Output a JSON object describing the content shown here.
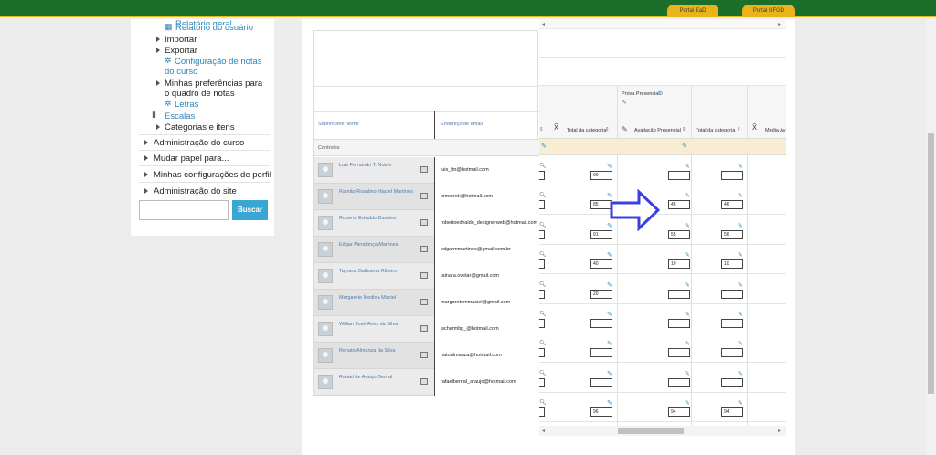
{
  "header": {
    "portal_ead": "Portal EaD",
    "portal_ufgd": "Portal UFGD"
  },
  "sidebar": {
    "partial_top": "Relatório geral",
    "relatorio_usuario": "Relatório do usuário",
    "importar": "Importar",
    "exportar": "Exportar",
    "config_notas": "Configuração de notas do curso",
    "preferencias": "Minhas preferências para o quadro de notas",
    "letras": "Letras",
    "escalas": "Escalas",
    "categorias": "Categorias e itens",
    "admin_curso": "Administração do curso",
    "mudar_papel": "Mudar papel para...",
    "minhas_config": "Minhas configurações de perfil",
    "admin_site": "Administração do site",
    "search_button": "Buscar"
  },
  "table": {
    "col_surname": "Sobrenome Nome",
    "col_email": "Endereço de email",
    "controls_label": "Controles",
    "category_title": "Prova Presencial",
    "col_total1": "Total da categoria",
    "col_avaliacao": "Avaliação Presencial",
    "col_total2": "Total da categoria",
    "col_media": "Media Av",
    "students": [
      {
        "name": "Luis Fernando T. Nobre",
        "email": "luis_ftn@hotmail.com",
        "g1": "90",
        "g2": "",
        "g3": ""
      },
      {
        "name": "Ramão Rosalino Maciel Martines",
        "email": "tomorrok@hotmail.com",
        "g1": "85",
        "g2": "45",
        "g3": "46"
      },
      {
        "name": "Roberto Edvaldo Davalos",
        "email": "robertoedvaldo_designerweb@hotmail.com",
        "g1": "91",
        "g2": "55",
        "g3": "56"
      },
      {
        "name": "Edgar Mendonça Martines",
        "email": "edgarmmartines@gmail.com.br",
        "g1": "40",
        "g2": "10",
        "g3": "10"
      },
      {
        "name": "Tayrana Balbuena Ribeiro",
        "email": "tainara.ovelar@gmail.com",
        "g1": "20",
        "g2": "",
        "g3": ""
      },
      {
        "name": "Margarete Medina Maciel",
        "email": "margaretemmaciel@gmail.com",
        "g1": "",
        "g2": "",
        "g3": ""
      },
      {
        "name": "Willian José Aires da Silva",
        "email": "wcharmbp_@hotmail.com",
        "g1": "",
        "g2": "",
        "g3": ""
      },
      {
        "name": "Renato Almanza da Silva",
        "email": "natoalmanza@hotmail.com",
        "g1": "",
        "g2": "",
        "g3": ""
      },
      {
        "name": "Rafael de Araujo Bernal",
        "email": "rafaelbernal_araujo@hotmail.com",
        "g1": "96",
        "g2": "94",
        "g3": "94"
      },
      {
        "name": "",
        "email": "",
        "g1": "98",
        "g2": "90",
        "g3": "90"
      }
    ]
  },
  "colors": {
    "accent_arrow": "#3b3fe0",
    "header_green": "#1b6f2a",
    "portal_yellow": "#e9b31a"
  }
}
